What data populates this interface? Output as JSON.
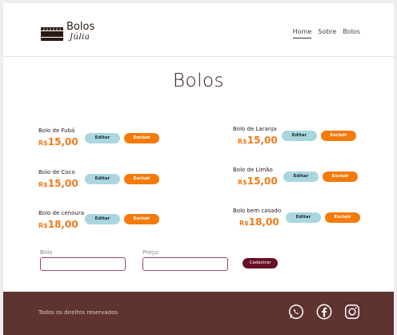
{
  "brand": {
    "line1": "Bolos",
    "line2": "Júlia"
  },
  "nav": {
    "home": "Home",
    "about": "Sobre",
    "cakes": "Bolos"
  },
  "page_title": "Bolos",
  "currency": "R$",
  "buttons": {
    "edit": "Editar",
    "delete": "Excluir",
    "register": "Cadastrar"
  },
  "cakes": [
    {
      "name": "Bolo de  Fubá",
      "price": "15,00"
    },
    {
      "name": "Bolo de Laranja",
      "price": "15,00"
    },
    {
      "name": "Bolo de Coco",
      "price": "15,00"
    },
    {
      "name": "Bolo de Limão",
      "price": "15,00"
    },
    {
      "name": "Bolo de cenoura",
      "price": "18,00"
    },
    {
      "name": "Bolo bem casado",
      "price": "18,00"
    }
  ],
  "form": {
    "cake_label": "Bolo",
    "price_label": "Preço",
    "cake_value": "",
    "price_value": ""
  },
  "footer": {
    "text": "Todos os direitos reservados"
  },
  "social": [
    "whatsapp-icon",
    "facebook-icon",
    "instagram-icon"
  ],
  "colors": {
    "accent_orange": "#f47a09",
    "edit_blue": "#a9d6df",
    "register_red": "#6a1024",
    "footer_brown": "#5e3330"
  }
}
